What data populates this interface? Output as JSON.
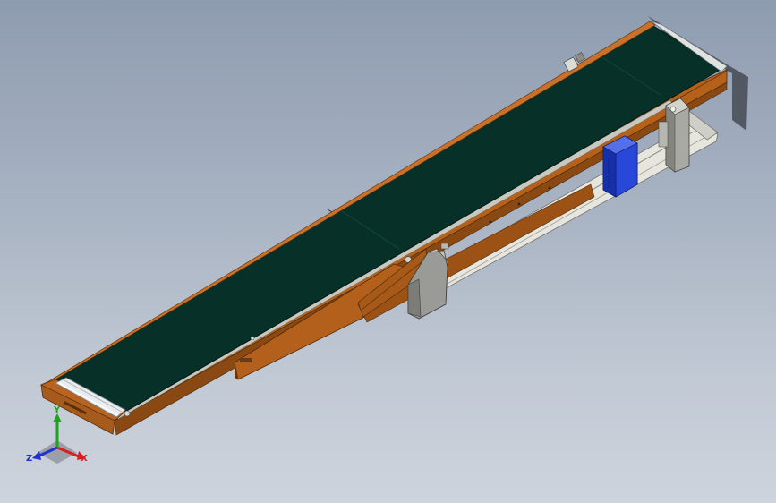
{
  "triad": {
    "x_label": "X",
    "y_label": "Y",
    "z_label": "Z",
    "x_color": "#d81e1e",
    "y_color": "#1aa51a",
    "z_color": "#2233cc"
  },
  "model": {
    "frame_color": "#b5611a",
    "belt_color": "#073128",
    "motor_color": "#1f3fc8",
    "bracket_color": "#9a9a96",
    "rail_color": "#d9d9d2"
  }
}
